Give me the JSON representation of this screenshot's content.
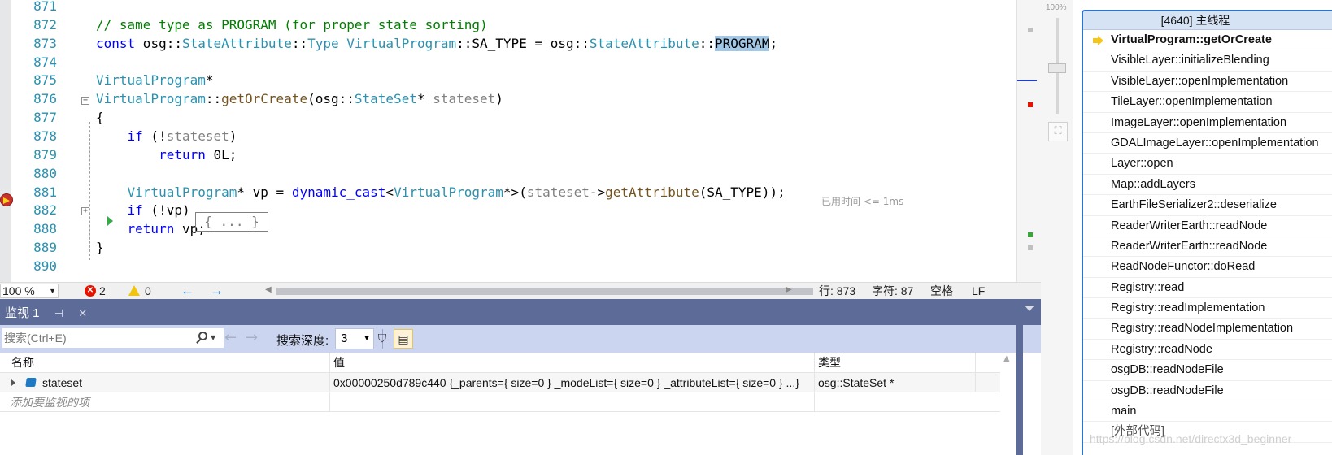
{
  "editor": {
    "lines": [
      {
        "num": "871",
        "parts": []
      },
      {
        "num": "872",
        "parts": [
          {
            "t": "cm",
            "text": "// same type as PROGRAM (for proper state sorting)"
          }
        ]
      },
      {
        "num": "873",
        "parts": [
          {
            "t": "kw",
            "text": "const"
          },
          {
            "t": "",
            "text": " osg::"
          },
          {
            "t": "ty",
            "text": "StateAttribute"
          },
          {
            "t": "",
            "text": "::"
          },
          {
            "t": "ty",
            "text": "Type"
          },
          {
            "t": "",
            "text": " "
          },
          {
            "t": "ty",
            "text": "VirtualProgram"
          },
          {
            "t": "",
            "text": "::SA_TYPE = osg::"
          },
          {
            "t": "ty",
            "text": "StateAttribute"
          },
          {
            "t": "",
            "text": "::"
          },
          {
            "t": "hl",
            "text": "PROGRAM"
          },
          {
            "t": "",
            "text": ";"
          }
        ]
      },
      {
        "num": "874",
        "parts": []
      },
      {
        "num": "875",
        "parts": [
          {
            "t": "ty",
            "text": "VirtualProgram"
          },
          {
            "t": "",
            "text": "*"
          }
        ]
      },
      {
        "num": "876",
        "parts": [
          {
            "t": "ty",
            "text": "VirtualProgram"
          },
          {
            "t": "",
            "text": "::"
          },
          {
            "t": "fn",
            "text": "getOrCreate"
          },
          {
            "t": "",
            "text": "(osg::"
          },
          {
            "t": "ty",
            "text": "StateSet"
          },
          {
            "t": "",
            "text": "* "
          },
          {
            "t": "pr",
            "text": "stateset"
          },
          {
            "t": "",
            "text": ")"
          }
        ]
      },
      {
        "num": "877",
        "parts": [
          {
            "t": "",
            "text": "{"
          }
        ]
      },
      {
        "num": "878",
        "parts": [
          {
            "t": "",
            "text": "    "
          },
          {
            "t": "kw",
            "text": "if"
          },
          {
            "t": "",
            "text": " (!"
          },
          {
            "t": "pr",
            "text": "stateset"
          },
          {
            "t": "",
            "text": ")"
          }
        ]
      },
      {
        "num": "879",
        "parts": [
          {
            "t": "",
            "text": "        "
          },
          {
            "t": "kw",
            "text": "return"
          },
          {
            "t": "",
            "text": " 0L;"
          }
        ]
      },
      {
        "num": "880",
        "parts": []
      },
      {
        "num": "881",
        "parts": [
          {
            "t": "",
            "text": "    "
          },
          {
            "t": "ty",
            "text": "VirtualProgram"
          },
          {
            "t": "",
            "text": "* vp = "
          },
          {
            "t": "kw",
            "text": "dynamic_cast"
          },
          {
            "t": "",
            "text": "<"
          },
          {
            "t": "ty",
            "text": "VirtualProgram"
          },
          {
            "t": "",
            "text": "*>("
          },
          {
            "t": "pr",
            "text": "stateset"
          },
          {
            "t": "",
            "text": "->"
          },
          {
            "t": "fn",
            "text": "getAttribute"
          },
          {
            "t": "",
            "text": "(SA_TYPE));"
          }
        ]
      },
      {
        "num": "882",
        "parts": [
          {
            "t": "",
            "text": "    "
          },
          {
            "t": "kw",
            "text": "if"
          },
          {
            "t": "",
            "text": " (!vp)"
          }
        ]
      },
      {
        "num": "888",
        "parts": [
          {
            "t": "",
            "text": "    "
          },
          {
            "t": "kw",
            "text": "return"
          },
          {
            "t": "",
            "text": " vp;"
          }
        ]
      },
      {
        "num": "889",
        "parts": [
          {
            "t": "",
            "text": "}"
          }
        ]
      },
      {
        "num": "890",
        "parts": []
      }
    ],
    "collapsed_text": "{ ... }",
    "perf_tip": "已用时间 <= 1ms"
  },
  "status": {
    "zoom": "100 %",
    "errors": "2",
    "warnings": "0",
    "line": "行: 873",
    "col": "字符: 87",
    "indent": "空格",
    "eol": "LF"
  },
  "watch": {
    "tab_title": "监视 1",
    "search_placeholder": "搜索(Ctrl+E)",
    "depth_label": "搜索深度:",
    "depth_value": "3",
    "columns": {
      "name": "名称",
      "value": "值",
      "type": "类型"
    },
    "rows": [
      {
        "name": "stateset",
        "value": "0x00000250d789c440 {_parents={ size=0 } _modeList={ size=0 } _attributeList={ size=0 } ...}",
        "type": "osg::StateSet *"
      }
    ],
    "add_item": "添加要监视的项"
  },
  "zoom_panel": {
    "label": "100%"
  },
  "threads": {
    "title": "[4640] 主线程",
    "frames": [
      "VirtualProgram::getOrCreate",
      "VisibleLayer::initializeBlending",
      "VisibleLayer::openImplementation",
      "TileLayer::openImplementation",
      "ImageLayer::openImplementation",
      "GDALImageLayer::openImplementation",
      "Layer::open",
      "Map::addLayers",
      "EarthFileSerializer2::deserialize",
      "ReaderWriterEarth::readNode",
      "ReaderWriterEarth::readNode",
      "ReadNodeFunctor::doRead",
      "Registry::read",
      "Registry::readImplementation",
      "Registry::readNodeImplementation",
      "Registry::readNode",
      "osgDB::readNodeFile",
      "osgDB::readNodeFile",
      "main",
      "[外部代码]"
    ]
  },
  "watermark": "https://blog.csdn.net/directx3d_beginner",
  "colors": {
    "accent": "#5d6b99",
    "breakpoint": "#c9302c",
    "current_frame": "#f5c518",
    "highlight": "#a3c8e6"
  }
}
